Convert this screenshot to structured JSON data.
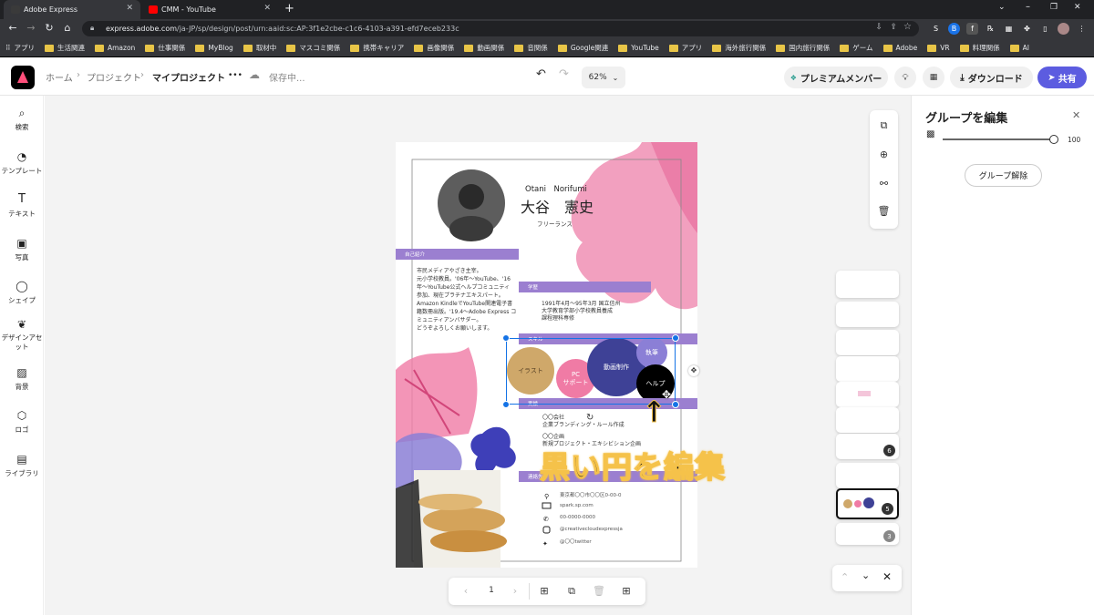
{
  "browser": {
    "tabs": [
      {
        "title": "Adobe Express",
        "active": true
      },
      {
        "title": "CMM - YouTube",
        "active": false
      }
    ],
    "new_tab": "+",
    "url_host": "express.adobe.com",
    "url_path": "/ja-JP/sp/design/post/urn:aaid:sc:AP:3f1e2cbe-c1c6-4103-a391-efd7eceb233c",
    "bookmarks": [
      "アプリ",
      "生活関連",
      "Amazon",
      "仕事関係",
      "MyBlog",
      "取材中",
      "マスコミ関係",
      "携帯キャリア",
      "画像関係",
      "動画関係",
      "音関係",
      "Google関連",
      "YouTube",
      "アプリ",
      "海外旅行関係",
      "国内旅行関係",
      "ゲーム",
      "Adobe",
      "VR",
      "料理関係",
      "AI"
    ]
  },
  "header": {
    "home": "ホーム",
    "projects": "プロジェクト",
    "my_project": "マイプロジェクト",
    "more": "•••",
    "saving": "保存中...",
    "zoom": "62%",
    "premium": "プレミアムメンバー",
    "download": "ダウンロード",
    "share": "共有"
  },
  "left_rail": [
    {
      "label": "検索",
      "icon": "search-icon"
    },
    {
      "label": "テンプレート",
      "icon": "template-icon"
    },
    {
      "label": "テキスト",
      "icon": "text-icon"
    },
    {
      "label": "写真",
      "icon": "photo-icon"
    },
    {
      "label": "シェイプ",
      "icon": "shape-icon"
    },
    {
      "label": "デザインアセット",
      "icon": "design-assets-icon"
    },
    {
      "label": "背景",
      "icon": "background-icon"
    },
    {
      "label": "ロゴ",
      "icon": "logo-icon"
    },
    {
      "label": "ライブラリ",
      "icon": "library-icon"
    }
  ],
  "right_panel": {
    "title": "グループを編集",
    "opacity_value": "100",
    "opacity_fraction": 1.0,
    "ungroup": "グループ解除"
  },
  "layers": {
    "badges": [
      "6",
      "5",
      "3"
    ]
  },
  "bottom_bar": {
    "page_number": "1"
  },
  "design": {
    "name_roman": "Otani　Norifumi",
    "name_jp": "大谷　憲史",
    "role": "フリーランス",
    "section_intro": "自己紹介",
    "intro_lines": [
      "市民メディアやざき主宰。",
      "元小学校教員。'06年～YouTube、'16",
      "年～YouTube公式ヘルプコミュニティ",
      "参加、現在プラチナエキスパート。",
      "Amazon KindleでYouTube関連電子書",
      "籍数冊出版。'19.4～Adobe Express コ",
      "ミュニティアンバサダー。",
      "どうぞよろしくお願いします。"
    ],
    "section_school": "学歴",
    "school_lines": [
      "1991年4月～95年3月 国立信州",
      "大学教育学部小学校教員養成",
      "課程理科専修"
    ],
    "section_skill": "スキル",
    "skills": {
      "illust": "イラスト",
      "pc": "PC\nサポート",
      "video": "動画制作",
      "writing": "執筆",
      "help": "ヘルプ"
    },
    "section_work": "実績",
    "work_lines": [
      "〇〇会社",
      "企業ブランディング・ルール作成",
      "",
      "〇〇企画",
      "新規プロジェクト・エキシビション企画"
    ],
    "section_contact": "連絡先",
    "contacts": [
      {
        "icon": "location-icon",
        "text": "東京都〇〇市〇〇区0-00-0"
      },
      {
        "icon": "mail-icon",
        "text": "spark.sp.com"
      },
      {
        "icon": "phone-icon",
        "text": "00-0000-0000"
      },
      {
        "icon": "instagram-icon",
        "text": "@creativecloudexpressja"
      },
      {
        "icon": "twitter-icon",
        "text": "@〇〇twitter"
      }
    ]
  },
  "annotation": "黒い円を編集"
}
